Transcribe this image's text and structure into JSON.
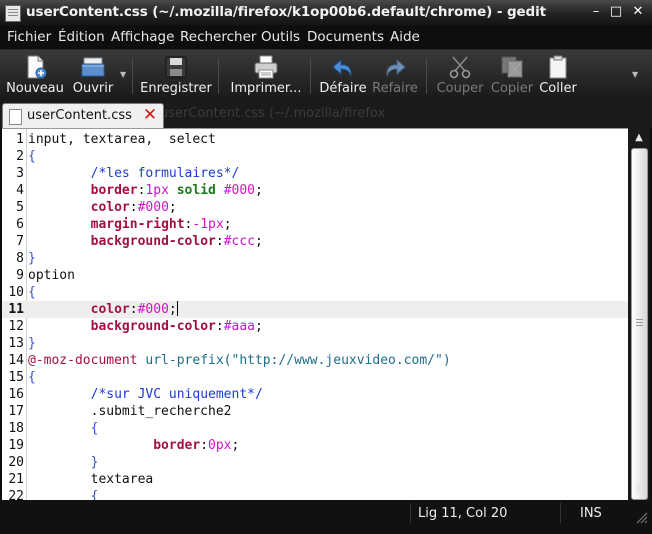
{
  "window": {
    "title": "userContent.css (~/.mozilla/firefox/k1op00b6.default/chrome) - gedit",
    "controls": {
      "minimize": "–",
      "maximize": "□",
      "close": "✕"
    }
  },
  "menu": [
    "Fichier",
    "Édition",
    "Affichage",
    "Rechercher",
    "Outils",
    "Documents",
    "Aide"
  ],
  "toolbar": {
    "nouveau": "Nouveau",
    "ouvrir": "Ouvrir",
    "enregistrer": "Enregistrer",
    "imprimer": "Imprimer...",
    "defaire": "Défaire",
    "refaire": "Refaire",
    "couper": "Couper",
    "copier": "Copier",
    "coller": "Coller"
  },
  "tab": {
    "label": "userContent.css",
    "ghost": "userContent.css (~/.mozilla/firefox"
  },
  "editor": {
    "current_line": 11,
    "lines": [
      [
        [
          "plain",
          "input, textarea,  select"
        ]
      ],
      [
        [
          "brace",
          "{"
        ]
      ],
      [
        [
          "plain",
          "        "
        ],
        [
          "comment",
          "/*les formulaires*/"
        ]
      ],
      [
        [
          "plain",
          "        "
        ],
        [
          "prop",
          "border"
        ],
        [
          "punct",
          ":"
        ],
        [
          "value",
          "1px"
        ],
        [
          "plain",
          " "
        ],
        [
          "keyword",
          "solid"
        ],
        [
          "plain",
          " "
        ],
        [
          "value",
          "#000"
        ],
        [
          "punct",
          ";"
        ]
      ],
      [
        [
          "plain",
          "        "
        ],
        [
          "prop",
          "color"
        ],
        [
          "punct",
          ":"
        ],
        [
          "value",
          "#000"
        ],
        [
          "punct",
          ";"
        ]
      ],
      [
        [
          "plain",
          "        "
        ],
        [
          "prop",
          "margin-right"
        ],
        [
          "punct",
          ":"
        ],
        [
          "value",
          "-1px"
        ],
        [
          "punct",
          ";"
        ]
      ],
      [
        [
          "plain",
          "        "
        ],
        [
          "prop",
          "background-color"
        ],
        [
          "punct",
          ":"
        ],
        [
          "value",
          "#ccc"
        ],
        [
          "punct",
          ";"
        ]
      ],
      [
        [
          "brace",
          "}"
        ]
      ],
      [
        [
          "plain",
          "option"
        ]
      ],
      [
        [
          "brace",
          "{"
        ]
      ],
      [
        [
          "plain",
          "        "
        ],
        [
          "prop",
          "color"
        ],
        [
          "punct",
          ":"
        ],
        [
          "value",
          "#000"
        ],
        [
          "punct",
          ";"
        ],
        [
          "cursor",
          ""
        ]
      ],
      [
        [
          "plain",
          "        "
        ],
        [
          "prop",
          "background-color"
        ],
        [
          "punct",
          ":"
        ],
        [
          "value",
          "#aaa"
        ],
        [
          "punct",
          ";"
        ]
      ],
      [
        [
          "brace",
          "}"
        ]
      ],
      [
        [
          "at",
          "@-moz-document"
        ],
        [
          "plain",
          " "
        ],
        [
          "url",
          "url-prefix(\"http://www.jeuxvideo.com/\")"
        ]
      ],
      [
        [
          "brace",
          "{"
        ]
      ],
      [
        [
          "plain",
          "        "
        ],
        [
          "comment",
          "/*sur JVC uniquement*/"
        ]
      ],
      [
        [
          "plain",
          "        .submit_recherche2"
        ]
      ],
      [
        [
          "plain",
          "        "
        ],
        [
          "brace",
          "{"
        ]
      ],
      [
        [
          "plain",
          "                "
        ],
        [
          "prop",
          "border"
        ],
        [
          "punct",
          ":"
        ],
        [
          "value",
          "0px"
        ],
        [
          "punct",
          ";"
        ]
      ],
      [
        [
          "plain",
          "        "
        ],
        [
          "brace",
          "}"
        ]
      ],
      [
        [
          "plain",
          "        textarea"
        ]
      ],
      [
        [
          "plain",
          "        "
        ],
        [
          "brace",
          "{"
        ]
      ]
    ]
  },
  "status": {
    "position": "Lig 11, Col 20",
    "mode": "INS"
  },
  "scrollbar": {
    "up": "▲",
    "down": "▼"
  },
  "colors": {
    "window_bg": "#0d0d0d",
    "editor_bg": "#ffffff",
    "current_line": "#eeeeec",
    "property": "#a0113f",
    "value": "#cf14c8",
    "comment": "#1a3ccf"
  }
}
